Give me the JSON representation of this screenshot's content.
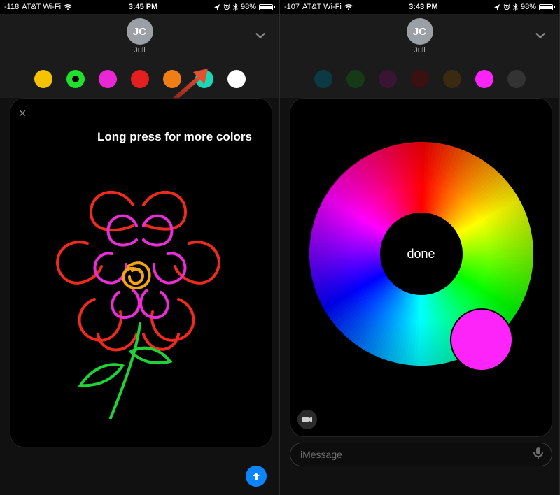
{
  "left": {
    "status": {
      "signal_text": "-118",
      "carrier": "AT&T Wi-Fi",
      "time": "3:45 PM",
      "battery_pct": "98%"
    },
    "header": {
      "avatar_initials": "JC",
      "name": "Juli"
    },
    "swatches": [
      {
        "color": "#f6c300",
        "selected": false
      },
      {
        "color": "#20e02a",
        "selected": true
      },
      {
        "color": "#ea27d4",
        "selected": false
      },
      {
        "color": "#e31f1f",
        "selected": false
      },
      {
        "color": "#ef7e16",
        "selected": false
      },
      {
        "color": "#18d8b7",
        "selected": false
      },
      {
        "color": "#ffffff",
        "selected": false
      }
    ],
    "canvas": {
      "close_label": "×",
      "caption": "Long press for more colors"
    }
  },
  "right": {
    "status": {
      "signal_text": "-107",
      "carrier": "AT&T Wi-Fi",
      "time": "3:43 PM",
      "battery_pct": "98%"
    },
    "header": {
      "avatar_initials": "JC",
      "name": "Juli"
    },
    "swatches_dim": [
      {
        "color": "#0c3a44"
      },
      {
        "color": "#153a15"
      },
      {
        "color": "#3a1433"
      },
      {
        "color": "#3a1010"
      },
      {
        "color": "#3a2a10"
      },
      {
        "color": "#fd24f9"
      },
      {
        "color": "#333333"
      }
    ],
    "wheel": {
      "done_label": "done",
      "picked_color": "#fd24f9"
    },
    "input": {
      "placeholder": "iMessage"
    }
  }
}
